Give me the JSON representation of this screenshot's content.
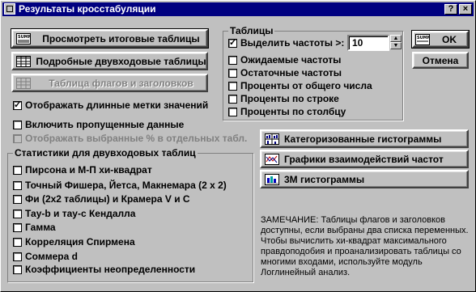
{
  "title": "Результаты кросстабуляции",
  "titlebar_buttons": {
    "help": "?",
    "close": "×"
  },
  "buttons": {
    "summary": "Просмотреть итоговые таблицы",
    "detailed": "Подробные двувходовые таблицы",
    "flags": "Таблица флагов и заголовков",
    "ok": "OK",
    "cancel": "Отмена",
    "categorized": "Категоризованные гистограммы",
    "interaction": "Графики взаимодействий частот",
    "histo3d": "3М гистограммы"
  },
  "checkboxes": {
    "long_labels": {
      "label": "Отображать длинные метки значений",
      "checked": true
    },
    "include_missing": {
      "label": "Включить пропущенные данные",
      "checked": false
    },
    "show_selected_pct": {
      "label": "Отображать выбранные % в отдельных табл.",
      "checked": false
    }
  },
  "tables_group": {
    "title": "Таблицы",
    "highlight": {
      "label": "Выделить частоты >:",
      "checked": true,
      "value": "10"
    },
    "items": [
      {
        "label": "Ожидаемые частоты",
        "checked": false
      },
      {
        "label": "Остаточные частоты",
        "checked": false
      },
      {
        "label": "Проценты от общего числа",
        "checked": false
      },
      {
        "label": "Проценты по строке",
        "checked": false
      },
      {
        "label": "Проценты по столбцу",
        "checked": false
      }
    ]
  },
  "stats_group": {
    "title": "Статистики для двувходовых таблиц",
    "items": [
      {
        "label": "Пирсона и М-П хи-квадрат",
        "checked": false
      },
      {
        "label": "Точный Фишера, Йетса, Макнемара (2 x 2)",
        "checked": false
      },
      {
        "label": "Фи (2x2 таблицы) и Крамера V и C",
        "checked": false
      },
      {
        "label": "Тау-b и тау-c Кендалла",
        "checked": false
      },
      {
        "label": "Гамма",
        "checked": false
      },
      {
        "label": "Корреляция Спирмена",
        "checked": false
      },
      {
        "label": "Соммера d",
        "checked": false
      },
      {
        "label": "Коэффициенты неопределенности",
        "checked": false
      }
    ]
  },
  "note": "ЗАМЕЧАНИЕ:  Таблицы флагов и заголовков доступны, если выбраны два списка переменных. Чтобы вычислить хи-квадрат максимального правдоподобия и проанализировать таблицы со многими входами, используйте модуль Логлинейный анализ.",
  "icons": {
    "summary": "table-summary-icon",
    "detailed": "table-grid-icon",
    "flags": "table-grid-icon",
    "categorized": "categorized-histogram-icon",
    "interaction": "interaction-plot-icon",
    "histo3d": "3d-histogram-icon"
  }
}
